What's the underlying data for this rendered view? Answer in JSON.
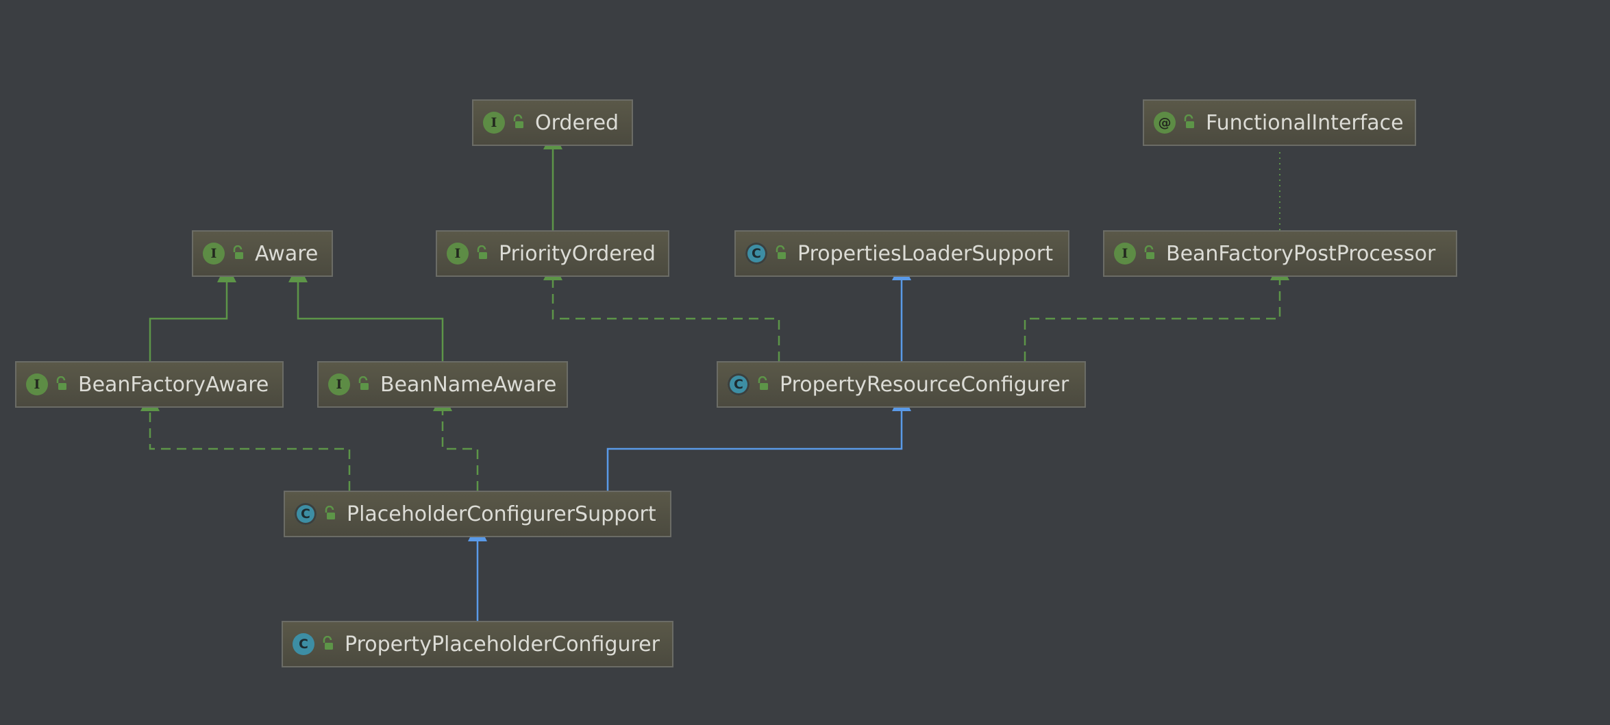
{
  "diagram": {
    "nodes": [
      {
        "id": "ordered",
        "label": "Ordered",
        "kind": "interface",
        "kind_glyph": "I"
      },
      {
        "id": "functional-interface",
        "label": "FunctionalInterface",
        "kind": "annotation",
        "kind_glyph": "@"
      },
      {
        "id": "aware",
        "label": "Aware",
        "kind": "interface",
        "kind_glyph": "I"
      },
      {
        "id": "priority-ordered",
        "label": "PriorityOrdered",
        "kind": "interface",
        "kind_glyph": "I"
      },
      {
        "id": "properties-loader-support",
        "label": "PropertiesLoaderSupport",
        "kind": "abstract",
        "kind_glyph": "C"
      },
      {
        "id": "bean-factory-post-processor",
        "label": "BeanFactoryPostProcessor",
        "kind": "interface",
        "kind_glyph": "I"
      },
      {
        "id": "bean-factory-aware",
        "label": "BeanFactoryAware",
        "kind": "interface",
        "kind_glyph": "I"
      },
      {
        "id": "bean-name-aware",
        "label": "BeanNameAware",
        "kind": "interface",
        "kind_glyph": "I"
      },
      {
        "id": "property-resource-configurer",
        "label": "PropertyResourceConfigurer",
        "kind": "abstract",
        "kind_glyph": "C"
      },
      {
        "id": "placeholder-configurer-support",
        "label": "PlaceholderConfigurerSupport",
        "kind": "abstract",
        "kind_glyph": "C"
      },
      {
        "id": "property-placeholder-configurer",
        "label": "PropertyPlaceholderConfigurer",
        "kind": "class",
        "kind_glyph": "C"
      }
    ],
    "edges": [
      {
        "from": "priority-ordered",
        "to": "ordered",
        "type": "interface-extends"
      },
      {
        "from": "bean-factory-aware",
        "to": "aware",
        "type": "interface-extends"
      },
      {
        "from": "bean-name-aware",
        "to": "aware",
        "type": "interface-extends"
      },
      {
        "from": "property-resource-configurer",
        "to": "priority-ordered",
        "type": "implements"
      },
      {
        "from": "property-resource-configurer",
        "to": "properties-loader-support",
        "type": "extends"
      },
      {
        "from": "property-resource-configurer",
        "to": "bean-factory-post-processor",
        "type": "implements"
      },
      {
        "from": "bean-factory-post-processor",
        "to": "functional-interface",
        "type": "annotated-by"
      },
      {
        "from": "placeholder-configurer-support",
        "to": "bean-factory-aware",
        "type": "implements"
      },
      {
        "from": "placeholder-configurer-support",
        "to": "bean-name-aware",
        "type": "implements"
      },
      {
        "from": "placeholder-configurer-support",
        "to": "property-resource-configurer",
        "type": "extends"
      },
      {
        "from": "property-placeholder-configurer",
        "to": "placeholder-configurer-support",
        "type": "extends"
      }
    ]
  },
  "colors": {
    "background": "#3b3e42",
    "interface_edge": "#5d9548",
    "class_edge": "#5a9ae8",
    "annotation_edge": "#5d9548"
  }
}
